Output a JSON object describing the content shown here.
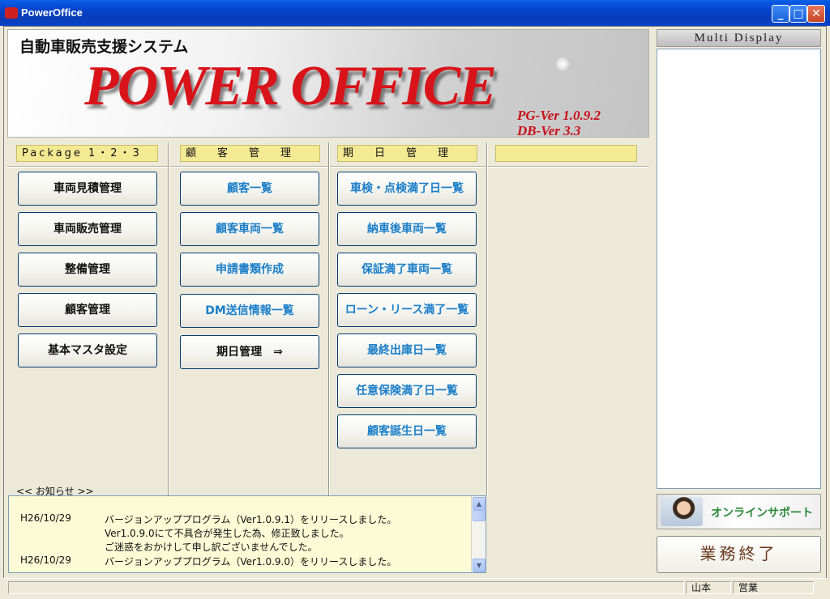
{
  "window": {
    "title": "PowerOffice"
  },
  "banner": {
    "subtitle": "自動車販売支援システム",
    "logo": "POWER OFFICE",
    "pg_version": "PG-Ver 1.0.9.2",
    "db_version": "DB-Ver 3.3"
  },
  "columns": {
    "package": {
      "header": "Package 1・2・3",
      "buttons": [
        "車両見積管理",
        "車両販売管理",
        "整備管理",
        "顧客管理",
        "基本マスタ設定"
      ]
    },
    "customer": {
      "header": "顧　　客　　管　　理",
      "buttons": [
        "顧客一覧",
        "顧客車両一覧",
        "申請書類作成",
        "DM送信情報一覧",
        "期日管理　⇒"
      ]
    },
    "date": {
      "header": "期　　日　　管　　理",
      "buttons": [
        "車検・点検満了日一覧",
        "納車後車両一覧",
        "保証満了車両一覧",
        "ローン・リース満了一覧",
        "最終出庫日一覧",
        "任意保険満了日一覧",
        "顧客誕生日一覧"
      ]
    },
    "extra": {
      "header": ""
    }
  },
  "news": {
    "label": "<< お知らせ >>",
    "items": [
      {
        "date": "H26/10/29",
        "text": "バージョンアッププログラム（Ver1.0.9.1）をリリースしました。"
      },
      {
        "date": "",
        "text": "Ver1.0.9.0にて不具合が発生した為、修正致しました。"
      },
      {
        "date": "",
        "text": "ご迷惑をおかけして申し訳ございませんでした。"
      },
      {
        "date": "H26/10/29",
        "text": "バージョンアッププログラム（Ver1.0.9.0）をリリースしました。"
      }
    ]
  },
  "side": {
    "multi_display": "Multi Display",
    "support_label": "オンラインサポート",
    "quit_label": "業務終了"
  },
  "status": {
    "user": "山本",
    "department": "営業"
  }
}
